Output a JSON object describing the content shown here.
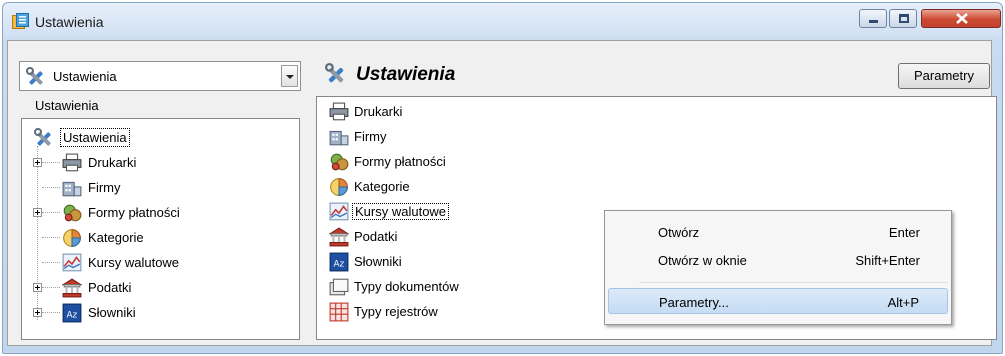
{
  "window": {
    "title": "Ustawienia",
    "icon": "settings-window-icon"
  },
  "left_pane": {
    "combo_value": "Ustawienia",
    "caption": "Ustawienia",
    "tree_root": "Ustawienia",
    "tree_items": [
      {
        "label": "Drukarki",
        "icon": "printer-icon",
        "expandable": true
      },
      {
        "label": "Firmy",
        "icon": "company-icon",
        "expandable": false
      },
      {
        "label": "Formy płatności",
        "icon": "payment-icon",
        "expandable": true
      },
      {
        "label": "Kategorie",
        "icon": "pie-chart-icon",
        "expandable": false
      },
      {
        "label": "Kursy walutowe",
        "icon": "chart-line-icon",
        "expandable": false
      },
      {
        "label": "Podatki",
        "icon": "bank-icon",
        "expandable": true
      },
      {
        "label": "Słowniki",
        "icon": "dictionary-icon",
        "expandable": true
      }
    ]
  },
  "right_pane": {
    "title": "Ustawienia",
    "param_button": "Parametry",
    "items": [
      {
        "label": "Drukarki",
        "icon": "printer-icon"
      },
      {
        "label": "Firmy",
        "icon": "company-icon"
      },
      {
        "label": "Formy płatności",
        "icon": "payment-icon"
      },
      {
        "label": "Kategorie",
        "icon": "pie-chart-icon"
      },
      {
        "label": "Kursy walutowe",
        "icon": "chart-line-icon",
        "selected": true
      },
      {
        "label": "Podatki",
        "icon": "bank-icon"
      },
      {
        "label": "Słowniki",
        "icon": "dictionary-icon"
      },
      {
        "label": "Typy dokumentów",
        "icon": "document-type-icon"
      },
      {
        "label": "Typy rejestrów",
        "icon": "register-type-icon"
      }
    ]
  },
  "context_menu": {
    "items": [
      {
        "label": "Otwórz",
        "shortcut": "Enter"
      },
      {
        "label": "Otwórz w oknie",
        "shortcut": "Shift+Enter"
      },
      {
        "label": "Parametry...",
        "shortcut": "Alt+P",
        "highlighted": true
      }
    ]
  },
  "colors": {
    "accent": "#c5dcf4",
    "close_button": "#cc4a33"
  }
}
